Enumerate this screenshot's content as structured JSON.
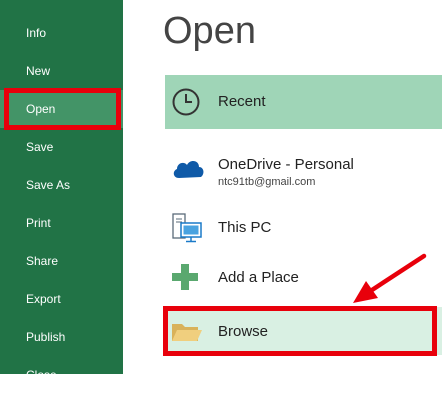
{
  "sidebar": {
    "items": [
      {
        "label": "Info"
      },
      {
        "label": "New"
      },
      {
        "label": "Open"
      },
      {
        "label": "Save"
      },
      {
        "label": "Save As"
      },
      {
        "label": "Print"
      },
      {
        "label": "Share"
      },
      {
        "label": "Export"
      },
      {
        "label": "Publish"
      },
      {
        "label": "Close"
      }
    ],
    "active_item": "Open"
  },
  "main": {
    "title": "Open",
    "places": {
      "recent": {
        "label": "Recent",
        "icon": "clock-icon"
      },
      "onedrive": {
        "label": "OneDrive - Personal",
        "account": "ntc91tb@gmail.com",
        "icon": "cloud-icon"
      },
      "this_pc": {
        "label": "This PC",
        "icon": "computer-icon"
      },
      "add_place": {
        "label": "Add a Place",
        "icon": "plus-icon"
      },
      "browse": {
        "label": "Browse",
        "icon": "folder-icon"
      }
    }
  },
  "colors": {
    "sidebar_bg": "#217346",
    "sidebar_active": "#439467",
    "recent_bg": "#9fd5b7",
    "browse_bg": "#d9f0e3",
    "highlight_red": "#e8000b"
  }
}
